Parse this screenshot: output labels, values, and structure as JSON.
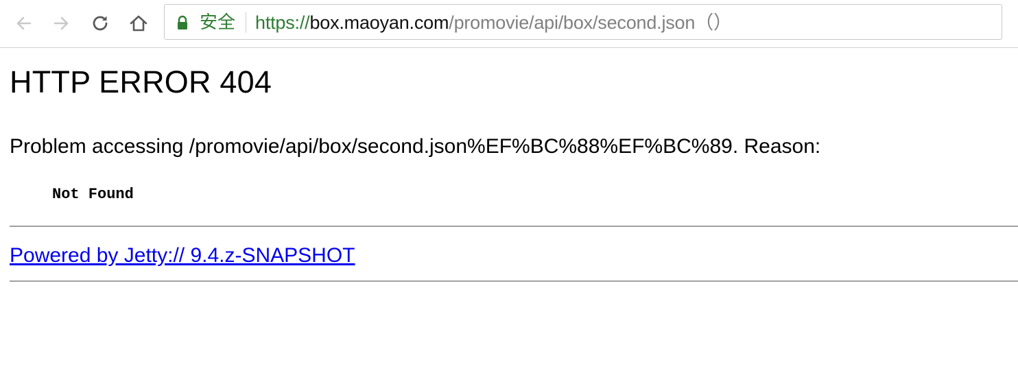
{
  "browser": {
    "security_label": "安全",
    "url": {
      "scheme": "https://",
      "host": "box.maoyan.com",
      "path": "/promovie/api/box/second.json（）"
    },
    "icons": {
      "back": "back-arrow-icon",
      "forward": "forward-arrow-icon",
      "reload": "reload-icon",
      "home": "home-icon",
      "lock": "lock-icon"
    },
    "colors": {
      "secure_green": "#2e7d32",
      "link_blue": "#0000ee"
    }
  },
  "page": {
    "title": "HTTP ERROR 404",
    "problem_text": "Problem accessing /promovie/api/box/second.json%EF%BC%88%EF%BC%89. Reason:",
    "reason": "Not Found",
    "footer_link": "Powered by Jetty:// 9.4.z-SNAPSHOT"
  }
}
